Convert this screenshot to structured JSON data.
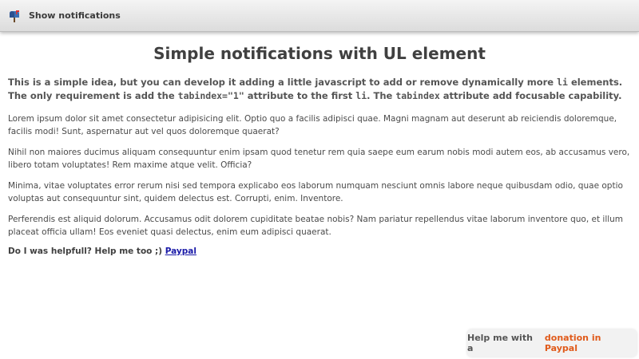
{
  "topbar": {
    "button_label": "Show notifications",
    "icon": "mailbox-icon"
  },
  "main": {
    "title": "Simple notifications with UL element",
    "lead": {
      "part1": "This is a simple idea, but you can develop it adding a little javascript to add or remove dynamically more ",
      "code1": "li",
      "part2": " elements. The only requirement is add the ",
      "code2": "tabindex=\"1\"",
      "part3": " attribute to the first ",
      "code3": "li",
      "part4": ". The ",
      "code4": "tabindex",
      "part5": " attribute add focusable capability."
    },
    "paragraphs": [
      "Lorem ipsum dolor sit amet consectetur adipisicing elit. Optio quo a facilis adipisci quae. Magni magnam aut deserunt ab reiciendis doloremque, facilis modi! Sunt, aspernatur aut vel quos doloremque quaerat?",
      "Nihil non maiores ducimus aliquam consequuntur enim ipsam quod tenetur rem quia saepe eum earum nobis modi autem eos, ab accusamus vero, libero totam voluptates! Rem maxime atque velit. Officia?",
      "Minima, vitae voluptates error rerum nisi sed tempora explicabo eos laborum numquam nesciunt omnis labore neque quibusdam odio, quae optio voluptas aut consequuntur sint, quidem delectus est. Corrupti, enim. Inventore.",
      "Perferendis est aliquid dolorum. Accusamus odit dolorem cupiditate beatae nobis? Nam pariatur repellendus vitae laborum inventore quo, et illum placeat officia ullam! Eos eveniet quasi delectus, enim eum adipisci quaerat."
    ],
    "help_text": "Do I was helpfull? Help me too ;)",
    "help_link": "Paypal"
  },
  "donate": {
    "prefix": "Help me with a",
    "link": "donation in Paypal"
  },
  "colors": {
    "link_blue": "#1a1aa8",
    "donate_orange": "#e05a1a",
    "text": "#404040"
  }
}
